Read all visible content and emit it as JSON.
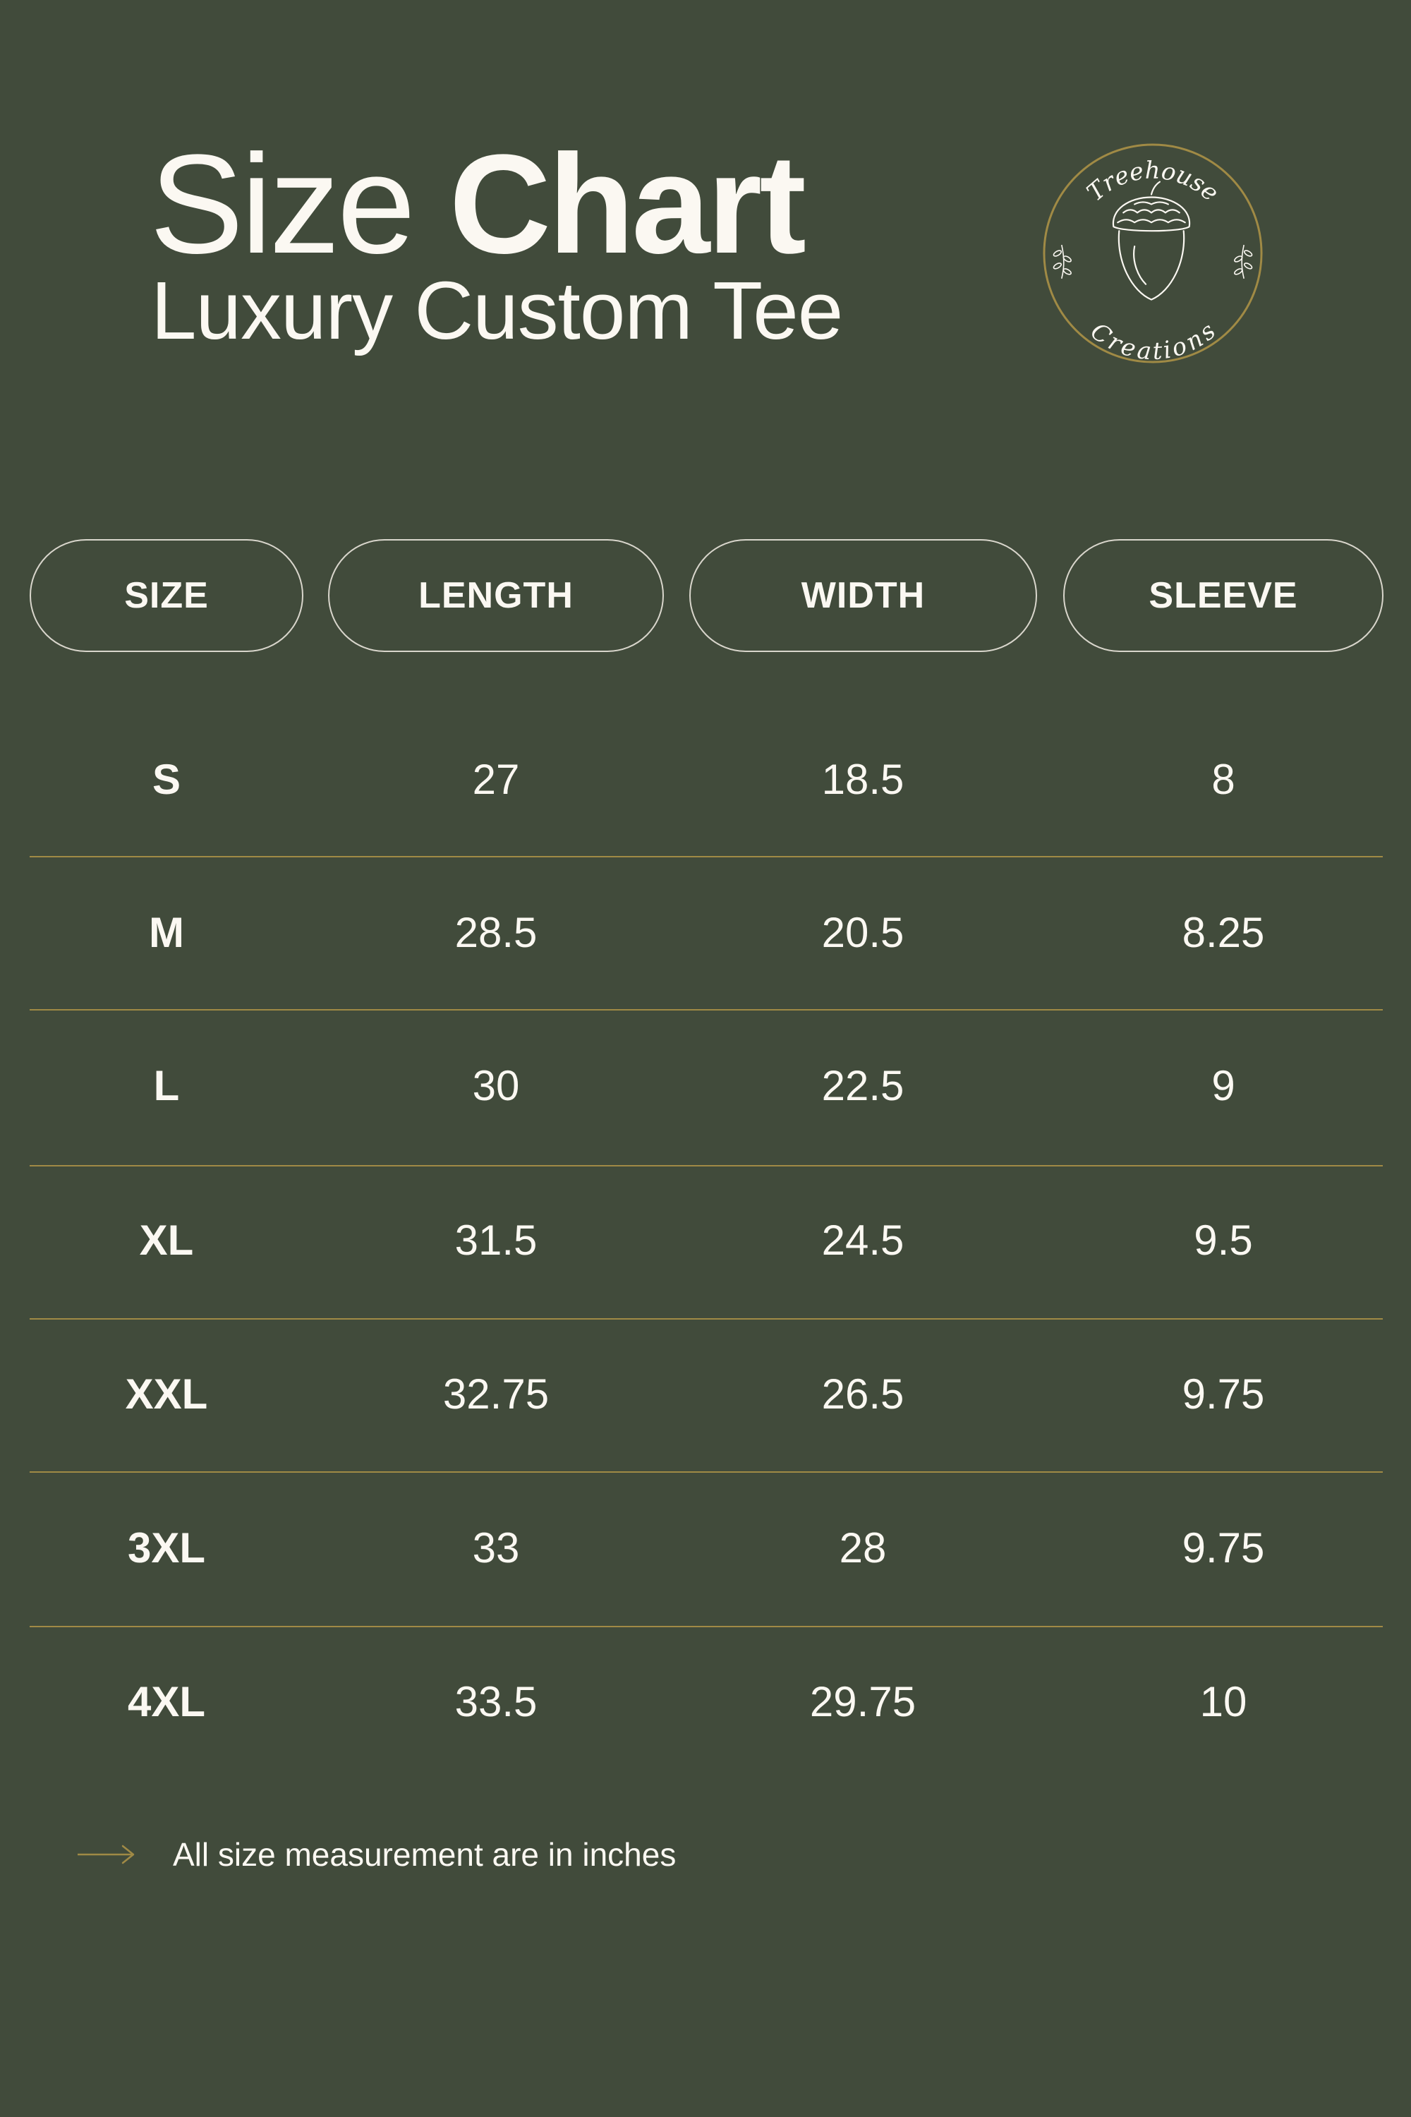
{
  "header": {
    "title_light": "Size",
    "title_bold": "Chart",
    "subtitle": "Luxury Custom Tee"
  },
  "logo": {
    "top_text": "Treehouse",
    "bottom_text": "Creations",
    "icon": "acorn-icon",
    "ring_color": "#a08a45"
  },
  "table": {
    "columns": [
      "SIZE",
      "LENGTH",
      "WIDTH",
      "SLEEVE"
    ],
    "rows": [
      [
        "S",
        "27",
        "18.5",
        "8"
      ],
      [
        "M",
        "28.5",
        "20.5",
        "8.25"
      ],
      [
        "L",
        "30",
        "22.5",
        "9"
      ],
      [
        "XL",
        "31.5",
        "24.5",
        "9.5"
      ],
      [
        "XXL",
        "32.75",
        "26.5",
        "9.75"
      ],
      [
        "3XL",
        "33",
        "28",
        "9.75"
      ],
      [
        "4XL",
        "33.5",
        "29.75",
        "10"
      ]
    ]
  },
  "note": {
    "icon": "arrow-right-icon",
    "text": "All size measurement are in inches"
  },
  "colors": {
    "background": "#414b3b",
    "text": "#fbf8f2",
    "accent": "#a08a45",
    "pill_border": "#d9d6cc"
  }
}
